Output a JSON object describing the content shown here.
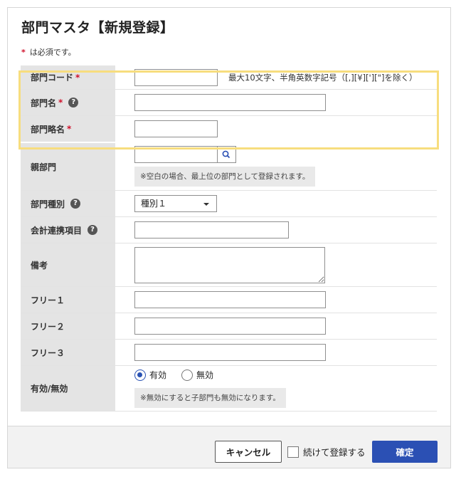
{
  "page": {
    "title": "部門マスタ【新規登録】",
    "required_note": "は必須です。",
    "required_mark": "*"
  },
  "fields": {
    "dept_code": {
      "label": "部門コード",
      "value": "",
      "hint": "最大10文字、半角英数字記号（[,][¥]['][\"]を除く）"
    },
    "dept_name": {
      "label": "部門名",
      "value": ""
    },
    "dept_short": {
      "label": "部門略名",
      "value": ""
    },
    "parent_dept": {
      "label": "親部門",
      "value": "",
      "note": "※空白の場合、最上位の部門として登録されます。"
    },
    "dept_type": {
      "label": "部門種別",
      "selected": "種別１"
    },
    "accounting_item": {
      "label": "会計連携項目",
      "value": ""
    },
    "remarks": {
      "label": "備考",
      "value": ""
    },
    "free1": {
      "label": "フリー１",
      "value": ""
    },
    "free2": {
      "label": "フリー２",
      "value": ""
    },
    "free3": {
      "label": "フリー３",
      "value": ""
    },
    "status": {
      "label": "有効/無効",
      "options": [
        "有効",
        "無効"
      ],
      "selected": "有効",
      "note": "※無効にすると子部門も無効になります。"
    }
  },
  "help_glyph": "?",
  "footer": {
    "cancel_label": "キャンセル",
    "continue_label": "続けて登録する",
    "continue_checked": false,
    "confirm_label": "確定"
  },
  "colors": {
    "required": "#d0112b",
    "primary": "#2b50b4",
    "highlight": "#f7dd7e",
    "label_bg": "#e4e4e4"
  },
  "icons": {
    "search": "search-icon",
    "help": "help-icon",
    "dropdown": "chevron-down-icon"
  }
}
